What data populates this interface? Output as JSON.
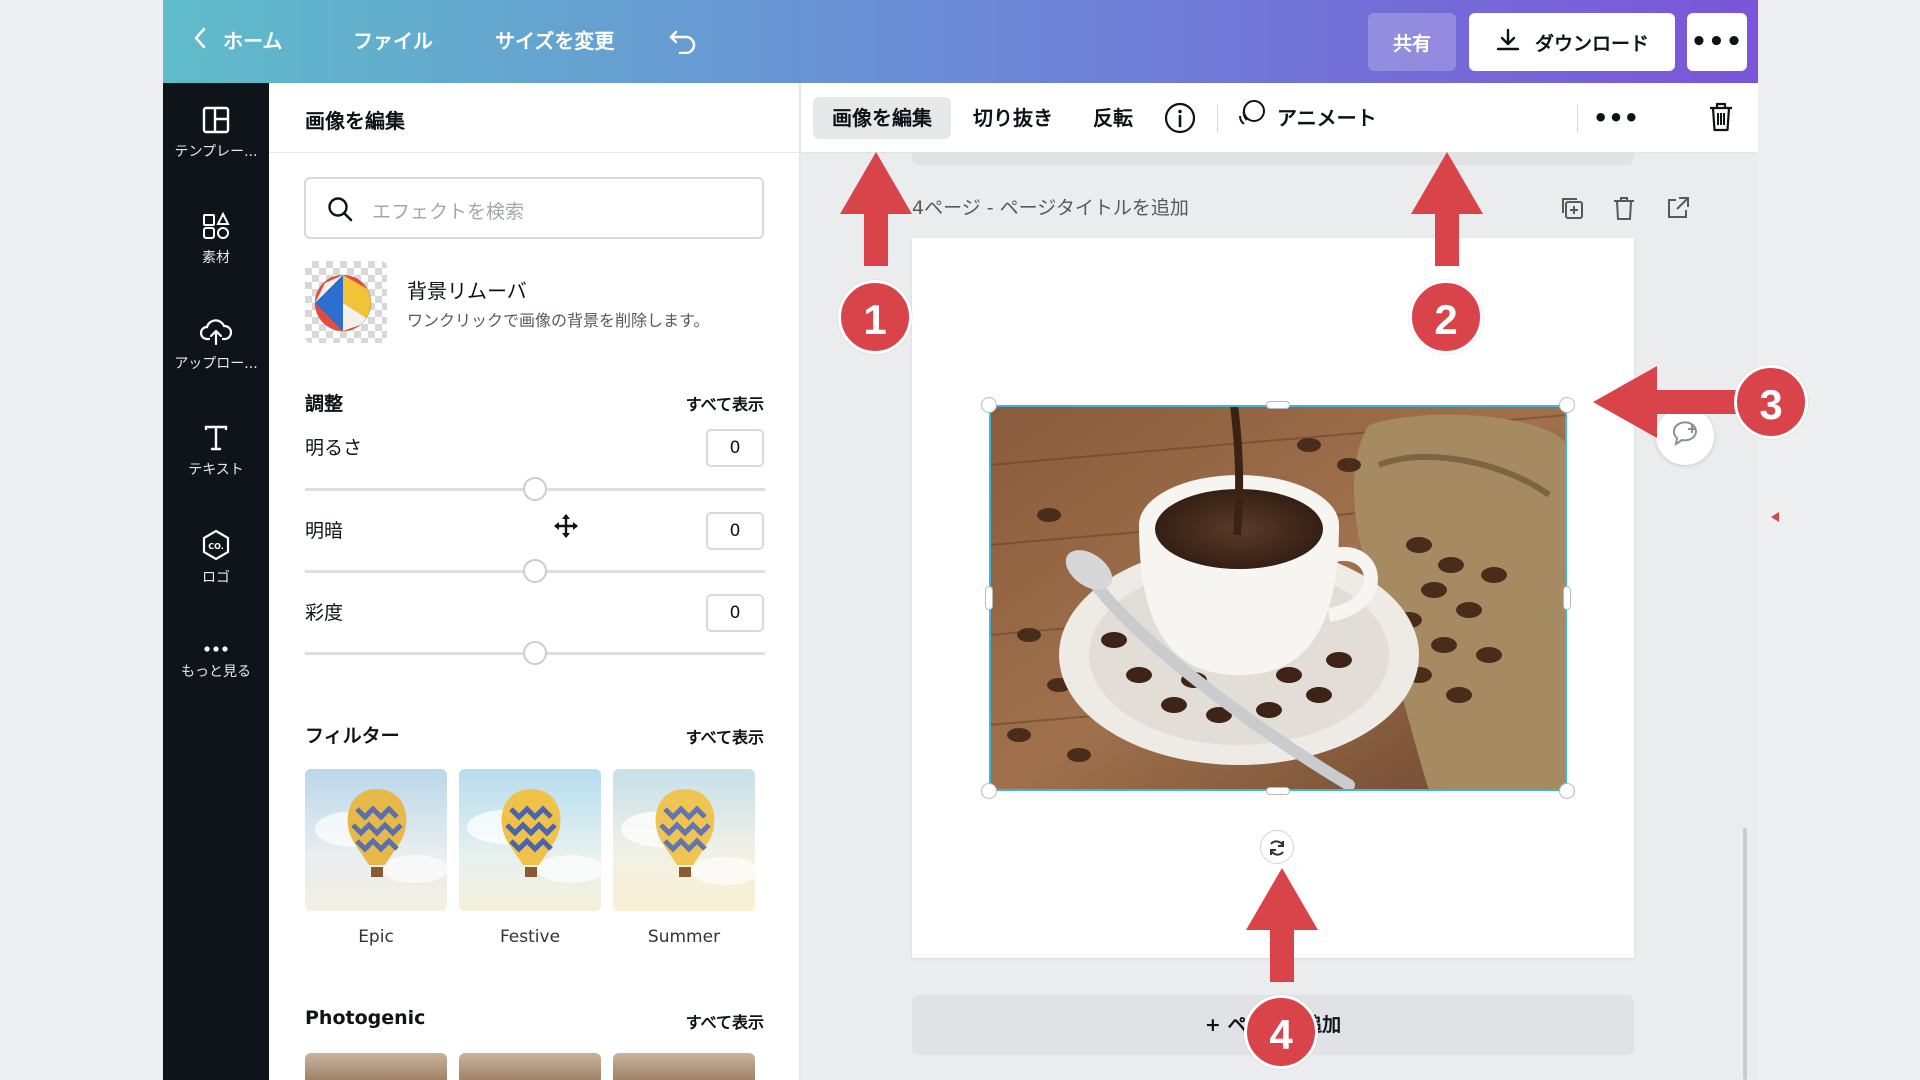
{
  "topbar": {
    "home_label": "ホーム",
    "file_label": "ファイル",
    "resize_label": "サイズを変更",
    "share_label": "共有",
    "download_label": "ダウンロード",
    "more_label": "•••"
  },
  "rail": {
    "items": [
      {
        "label": "テンプレー...",
        "icon": "template-icon"
      },
      {
        "label": "素材",
        "icon": "elements-icon"
      },
      {
        "label": "アップロー...",
        "icon": "upload-icon"
      },
      {
        "label": "テキスト",
        "icon": "text-icon"
      },
      {
        "label": "ロゴ",
        "icon": "logo-icon"
      },
      {
        "label": "もっと見る",
        "icon": "more-icon"
      }
    ]
  },
  "panel": {
    "title": "画像を編集",
    "search_placeholder": "エフェクトを検索",
    "bg_remover": {
      "title": "背景リムーバ",
      "desc": "ワンクリックで画像の背景を削除します。"
    },
    "adjust": {
      "title": "調整",
      "see_all": "すべて表示",
      "items": [
        {
          "label": "明るさ",
          "value": "0"
        },
        {
          "label": "明暗",
          "value": "0"
        },
        {
          "label": "彩度",
          "value": "0"
        }
      ]
    },
    "filters": {
      "title": "フィルター",
      "see_all": "すべて表示",
      "items": [
        {
          "name": "Epic"
        },
        {
          "name": "Festive"
        },
        {
          "name": "Summer"
        }
      ]
    },
    "photogenic": {
      "title": "Photogenic",
      "see_all": "すべて表示"
    }
  },
  "toolbar": {
    "edit_image": "画像を編集",
    "crop": "切り抜き",
    "flip": "反転",
    "animate": "アニメート",
    "more": "•••"
  },
  "page": {
    "header": "4ページ - ページタイトルを追加",
    "add_page": "+ ページを追加"
  },
  "annotations": [
    "1",
    "2",
    "3",
    "4"
  ],
  "colors": {
    "accent_red": "#d9434a",
    "selection": "#3fb5d6",
    "rail_bg": "#0f141b"
  }
}
